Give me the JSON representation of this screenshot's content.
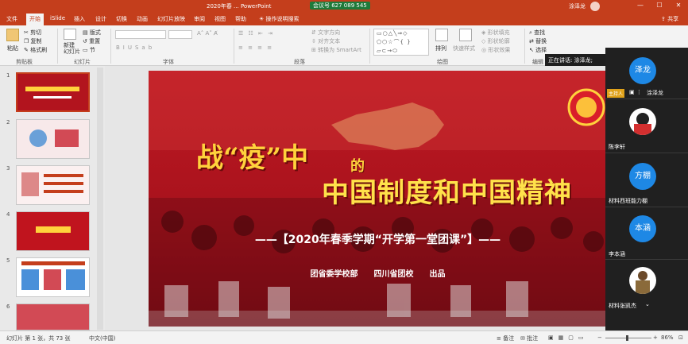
{
  "window": {
    "title": "2020年春 ... PowerPoint",
    "meeting_id": "会议号 627 089 545",
    "user": "涂泽龙",
    "win_min": "—",
    "win_max": "☐",
    "win_close": "✕"
  },
  "tabs": [
    "文件",
    "开始",
    "iSlide",
    "插入",
    "设计",
    "切换",
    "动画",
    "幻灯片放映",
    "审阅",
    "视图",
    "帮助",
    "操作说明搜索"
  ],
  "share_label": "共享",
  "ribbon": {
    "paste": "粘贴",
    "cut": "剪切",
    "copy": "复制",
    "format_painter": "格式刷",
    "new_slide": "新建\n幻灯片",
    "layout": "版式",
    "reset": "重置",
    "section": "节",
    "text_direction": "文字方向",
    "align_text": "对齐文本",
    "convert_smartart": "转换为 SmartArt",
    "arrange": "排列",
    "quick_styles": "快速样式",
    "shape_fill": "形状填充",
    "shape_outline": "形状轮廓",
    "shape_effects": "形状效果",
    "find": "查找",
    "replace": "替换",
    "select": "选择",
    "groups": {
      "clipboard": "剪贴板",
      "slides": "幻灯片",
      "font": "字体",
      "paragraph": "段落",
      "drawing": "绘图",
      "editing": "编辑"
    }
  },
  "speaking_banner": "正在讲话: 涂泽龙;",
  "slide": {
    "title_part1": "战“疫”中",
    "title_de": "的",
    "title_main": "中国制度和中国精神",
    "subtitle": "——【2020年春季学期“开学第一堂团课”】——",
    "publisher": "团省委学校部　　四川省团校　　出品"
  },
  "participants": [
    {
      "avatar_text": "泽龙",
      "name": "涂泽龙",
      "tag": "主持人",
      "avatar_color": "#1e88e5"
    },
    {
      "avatar_text": "",
      "name": "陈李轩",
      "tag": "",
      "avatar_color": "#ffffff"
    },
    {
      "avatar_text": "方棚",
      "name": "材料西班能力棚",
      "tag": "",
      "avatar_color": "#1e88e5"
    },
    {
      "avatar_text": "本涵",
      "name": "李本涵",
      "tag": "",
      "avatar_color": "#1e88e5"
    },
    {
      "avatar_text": "",
      "name": "材料张凯杰",
      "tag": "",
      "avatar_color": "#ffffff"
    }
  ],
  "thumbnails": [
    "1",
    "2",
    "3",
    "4",
    "5",
    "6"
  ],
  "status": {
    "slide_count": "幻灯片 第 1 张，共 73 张",
    "language": "中文(中国)",
    "notes": "备注",
    "comments": "批注",
    "zoom": "86%"
  },
  "colors": {
    "accent": "#c43e1c",
    "slide_bg": "#b2141e",
    "title_yellow": "#ffd23c"
  }
}
